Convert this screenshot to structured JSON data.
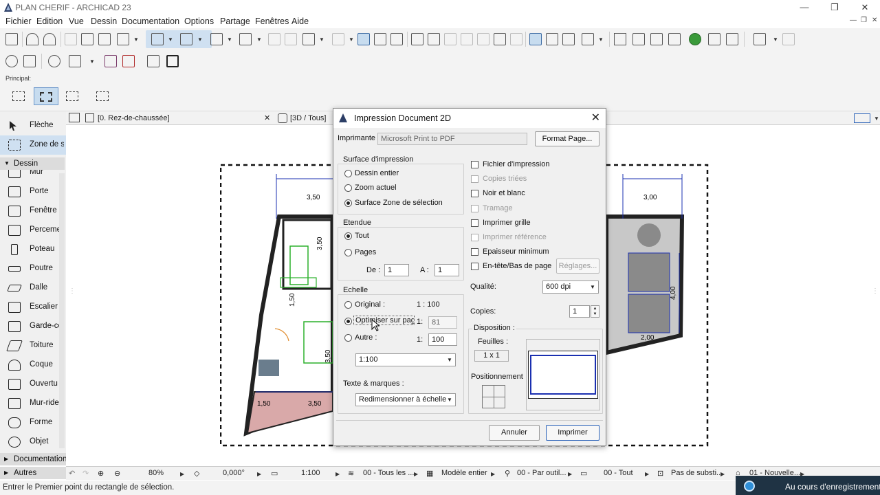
{
  "window": {
    "title": "PLAN CHERIF - ARCHICAD 23",
    "minimize": "—",
    "restore": "❐",
    "close": "✕"
  },
  "menubar": [
    "Fichier",
    "Edition",
    "Vue",
    "Dessin",
    "Documentation",
    "Options",
    "Partage",
    "Fenêtres",
    "Aide"
  ],
  "mdi_controls": [
    "—",
    "❐",
    "✕"
  ],
  "principal_label": "Principal:",
  "toolbox": {
    "tools_top": [
      {
        "label": "Flèche",
        "icon": "arrow-pointer-icon"
      },
      {
        "label": "Zone de sé",
        "icon": "marquee-icon"
      }
    ],
    "section_dessin": "Dessin",
    "tools": [
      {
        "label": "Mur",
        "icon": "wall-icon"
      },
      {
        "label": "Porte",
        "icon": "door-icon"
      },
      {
        "label": "Fenêtre",
        "icon": "window-icon"
      },
      {
        "label": "Perceme",
        "icon": "opening-icon"
      },
      {
        "label": "Poteau",
        "icon": "column-icon"
      },
      {
        "label": "Poutre",
        "icon": "beam-icon"
      },
      {
        "label": "Dalle",
        "icon": "slab-icon"
      },
      {
        "label": "Escalier",
        "icon": "stair-icon"
      },
      {
        "label": "Garde-co",
        "icon": "railing-icon"
      },
      {
        "label": "Toiture",
        "icon": "roof-icon"
      },
      {
        "label": "Coque",
        "icon": "shell-icon"
      },
      {
        "label": "Ouvertu",
        "icon": "skylight-icon"
      },
      {
        "label": "Mur-ride",
        "icon": "curtain-wall-icon"
      },
      {
        "label": "Forme",
        "icon": "morph-icon"
      },
      {
        "label": "Objet",
        "icon": "object-icon"
      }
    ],
    "section_documentation": "Documentation",
    "section_autres": "Autres"
  },
  "tabs": {
    "plan_tab": "[0. Rez-de-chaussée]",
    "plan_close": "✕",
    "tab_3d": "[3D / Tous]"
  },
  "plan_dims": [
    "3,50",
    "3,50",
    "1,50",
    "3,00",
    "4,00",
    "2,00",
    "3,50",
    "1,50",
    "3,50"
  ],
  "statusrow": {
    "zoom": "80%",
    "angle": "0,000°",
    "scale": "1:100",
    "layers": "00 - Tous les ...",
    "model": "Modèle entier",
    "pen": "00 - Par outil...",
    "view": "00 - Tout",
    "subst": "Pas de substi...",
    "renov": "01 - Nouvelle..."
  },
  "statusbar_text": "Entrer le Premier point du rectangle de sélection.",
  "recording": "Au cours d'enregistrement",
  "dialog": {
    "title": "Impression Document 2D",
    "close": "✕",
    "printer_label": "Imprimante",
    "printer_value": "Microsoft Print to PDF",
    "format_button": "Format Page...",
    "surface": {
      "title": "Surface d'impression",
      "options": [
        "Dessin entier",
        "Zoom actuel",
        "Surface Zone de sélection"
      ],
      "selected": 2
    },
    "etendue": {
      "title": "Etendue",
      "options": [
        "Tout",
        "Pages"
      ],
      "selected": 0,
      "de_label": "De :",
      "de_value": "1",
      "a_label": "A :",
      "a_value": "1"
    },
    "echelle": {
      "title": "Echelle",
      "original_label": "Original :",
      "original_value": "1 : 100",
      "optimiser_label": "Optimiser sur page",
      "optimiser_prefix": "1:",
      "optimiser_value": "81",
      "autre_label": "Autre :",
      "autre_prefix": "1:",
      "autre_value": "100",
      "scale_select": "1:100",
      "selected": 1
    },
    "texte_label": "Texte & marques :",
    "texte_select": "Redimensionner à échelle",
    "checks": [
      {
        "label": "Fichier d'impression",
        "disabled": false
      },
      {
        "label": "Copies triées",
        "disabled": true
      },
      {
        "label": "Noir et blanc",
        "disabled": false
      },
      {
        "label": "Tramage",
        "disabled": true
      },
      {
        "label": "Imprimer grille",
        "disabled": false
      },
      {
        "label": "Imprimer référence",
        "disabled": true
      },
      {
        "label": "Epaisseur minimum",
        "disabled": false
      },
      {
        "label": "En-tête/Bas de page",
        "disabled": false
      }
    ],
    "reglages_button": "Réglages...",
    "qualite_label": "Qualité:",
    "qualite_value": "600 dpi",
    "copies_label": "Copies:",
    "copies_value": "1",
    "disposition": {
      "title": "Disposition :",
      "feuilles_label": "Feuilles :",
      "feuilles_value": "1 x 1",
      "positionnement_label": "Positionnement"
    },
    "annuler": "Annuler",
    "imprimer": "Imprimer"
  },
  "colors": {
    "accent": "#2a62b8",
    "selection": "#cfe0f1",
    "plan_pink": "#d9a9a9",
    "plan_green": "#2bb02b",
    "dim_blue": "#1a2fb0"
  }
}
